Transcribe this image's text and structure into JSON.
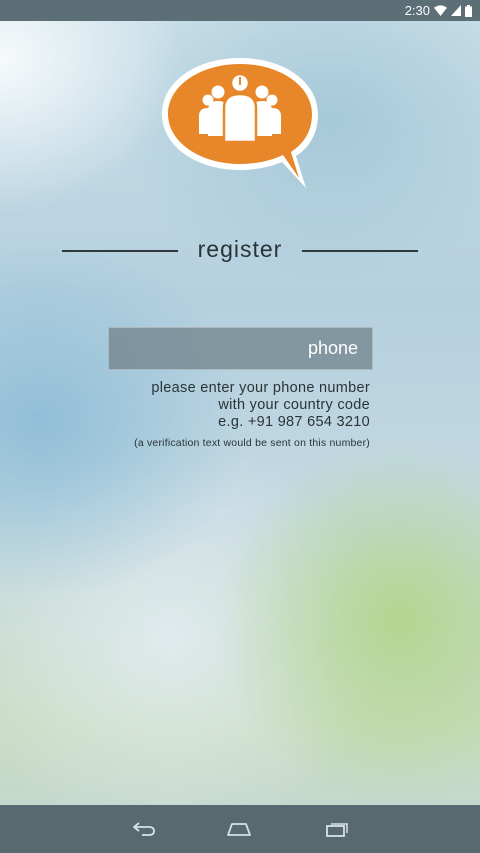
{
  "status_bar": {
    "time": "2:30",
    "icons": [
      "wifi-icon",
      "signal-icon",
      "battery-icon"
    ]
  },
  "logo": {
    "icon": "people-chat-bubble-logo",
    "color": "#e8862a"
  },
  "register": {
    "title": "register"
  },
  "phone": {
    "placeholder": "phone",
    "value": ""
  },
  "help": {
    "line1": "please enter your phone number",
    "line2": "with your country code",
    "line3": "e.g. +91 987 654 3210",
    "note": "(a verification text would be sent on this number)"
  },
  "nav_bar": {
    "icons": [
      "back-icon",
      "home-icon",
      "recents-icon"
    ]
  }
}
